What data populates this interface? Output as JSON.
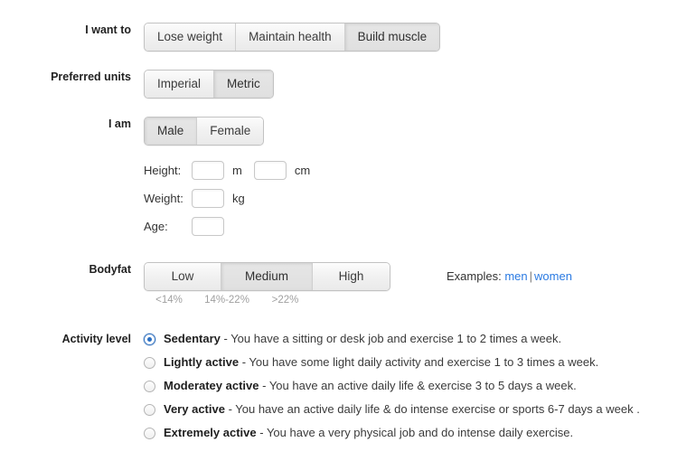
{
  "rows": {
    "goal": {
      "label": "I want to",
      "options": [
        "Lose weight",
        "Maintain health",
        "Build muscle"
      ],
      "selected": "Build muscle"
    },
    "units": {
      "label": "Preferred units",
      "options": [
        "Imperial",
        "Metric"
      ],
      "selected": "Metric"
    },
    "gender": {
      "label": "I am",
      "options": [
        "Male",
        "Female"
      ],
      "selected": "Male"
    },
    "measurements": {
      "height": {
        "label": "Height:",
        "value_m": "",
        "unit_m": "m",
        "value_cm": "",
        "unit_cm": "cm"
      },
      "weight": {
        "label": "Weight:",
        "value": "",
        "unit": "kg"
      },
      "age": {
        "label": "Age:",
        "value": ""
      }
    },
    "bodyfat": {
      "label": "Bodyfat",
      "options": [
        "Low",
        "Medium",
        "High"
      ],
      "selected": "Medium",
      "scale": [
        "<14%",
        "14%-22%",
        ">22%"
      ],
      "examples_label": "Examples:",
      "examples_links": [
        "men",
        "women"
      ],
      "examples_separator": "|"
    },
    "activity": {
      "label": "Activity level",
      "selected": "Sedentary",
      "items": [
        {
          "name": "Sedentary",
          "description": " - You have a sitting or desk job and exercise 1 to 2 times a week.",
          "checked": true
        },
        {
          "name": "Lightly active",
          "description": " - You have some light daily activity and exercise 1 to 3 times a week.",
          "checked": false
        },
        {
          "name": "Moderatey active",
          "description": " - You have an active daily life & exercise 3 to 5 days a week.",
          "checked": false
        },
        {
          "name": "Very active",
          "description": " - You have an active daily life & do intense exercise or sports 6-7 days a week .",
          "checked": false
        },
        {
          "name": "Extremely active",
          "description": " - You have a very physical job and do intense daily exercise.",
          "checked": false
        }
      ]
    }
  },
  "colors": {
    "link": "#2a7ae2",
    "radio_accent": "#2a6fc4",
    "selected_segment": "#e3e3e3",
    "muted_text": "#a0a0a0"
  }
}
